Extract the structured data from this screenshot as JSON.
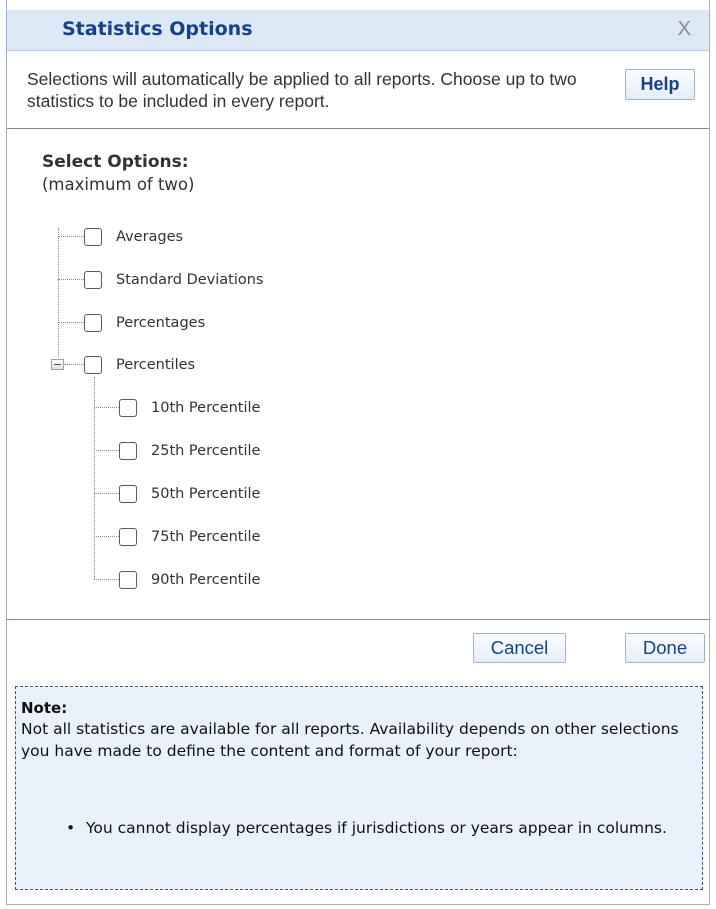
{
  "dialog": {
    "title": "Statistics Options",
    "close_label": "X"
  },
  "intro": {
    "text": "Selections will automatically be applied to all reports. Choose up to two statistics to be included in every report.",
    "help_label": "Help"
  },
  "options": {
    "heading": "Select Options:",
    "subheading": "(maximum of two)",
    "items": [
      {
        "label": "Averages",
        "checked": false
      },
      {
        "label": "Standard Deviations",
        "checked": false
      },
      {
        "label": "Percentages",
        "checked": false
      },
      {
        "label": "Percentiles",
        "checked": false,
        "expanded": true
      }
    ],
    "percentiles": [
      {
        "label": "10th Percentile",
        "checked": false
      },
      {
        "label": "25th Percentile",
        "checked": false
      },
      {
        "label": "50th Percentile",
        "checked": false
      },
      {
        "label": "75th Percentile",
        "checked": false
      },
      {
        "label": "90th Percentile",
        "checked": false
      }
    ]
  },
  "actions": {
    "cancel_label": "Cancel",
    "done_label": "Done"
  },
  "note": {
    "title": "Note:",
    "body": "Not all statistics are available for all reports. Availability depends on other selections you have made to define the content and format of your report:",
    "bullets": [
      "You cannot display percentages if jurisdictions or years appear in columns."
    ]
  },
  "colors": {
    "title_text": "#15428b",
    "titlebar_bg": "#dce8f5",
    "note_bg": "#e9f1fa",
    "note_border": "#3a5a80"
  }
}
